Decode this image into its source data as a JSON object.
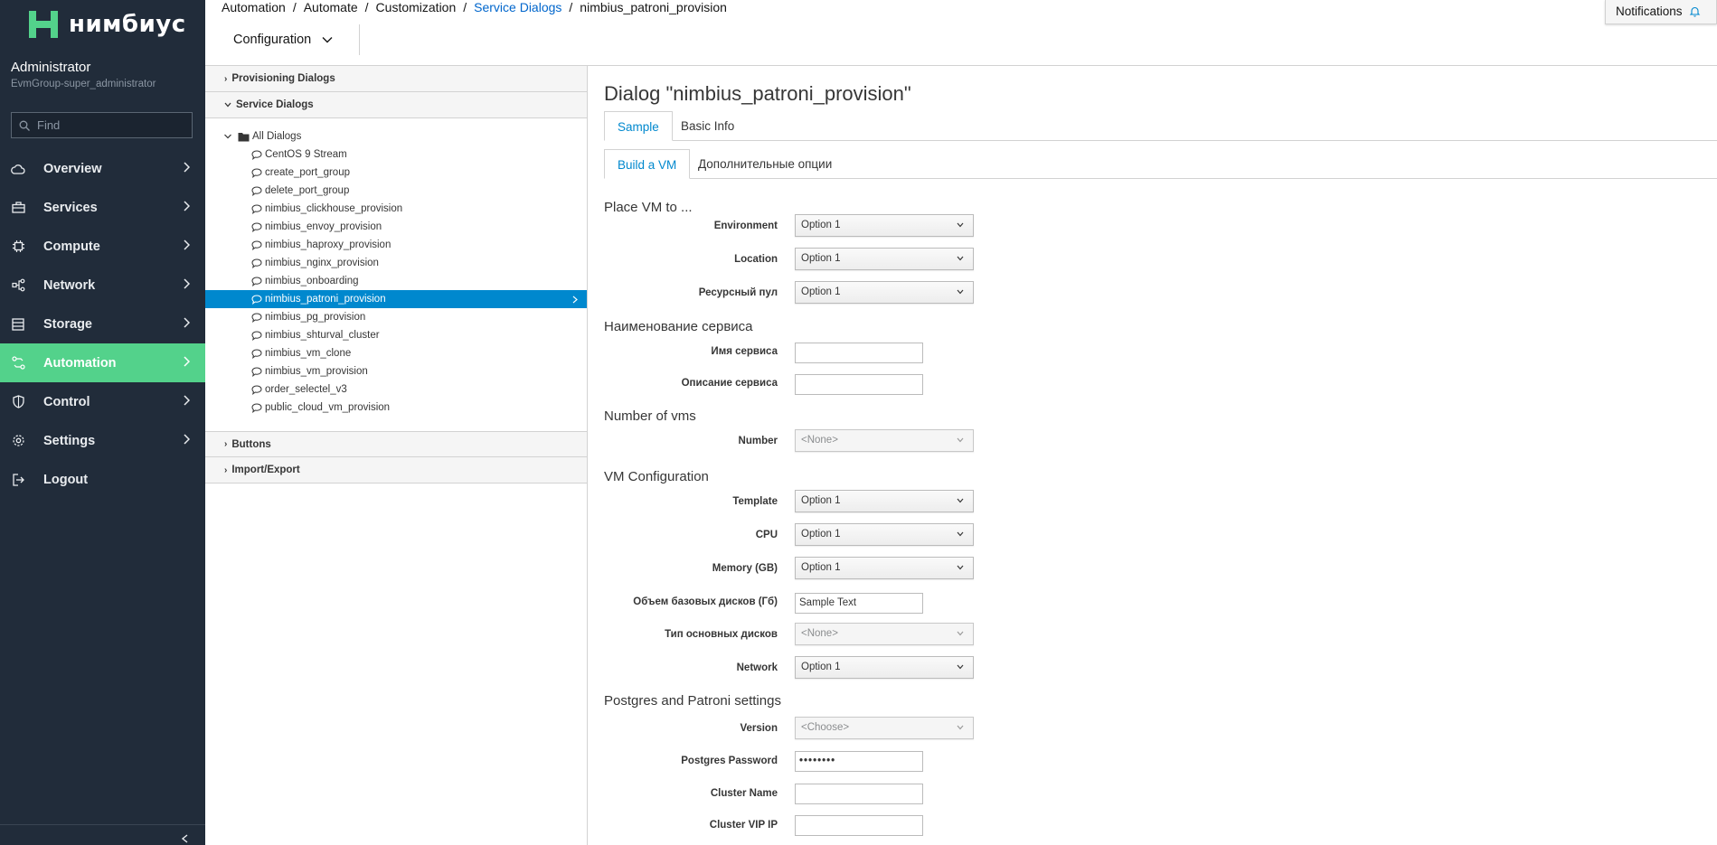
{
  "app": {
    "brand": "нимбиус",
    "user_name": "Administrator",
    "user_group": "EvmGroup-super_administrator",
    "find_placeholder": "Find",
    "brand_color": "#53d28b",
    "sidebar_bg": "#212c3a"
  },
  "nav": [
    {
      "label": "Overview",
      "icon": "cloud-icon",
      "active": false
    },
    {
      "label": "Services",
      "icon": "briefcase-icon",
      "active": false
    },
    {
      "label": "Compute",
      "icon": "cpu-icon",
      "active": false
    },
    {
      "label": "Network",
      "icon": "network-icon",
      "active": false
    },
    {
      "label": "Storage",
      "icon": "storage-icon",
      "active": false
    },
    {
      "label": "Automation",
      "icon": "automation-icon",
      "active": true
    },
    {
      "label": "Control",
      "icon": "shield-icon",
      "active": false
    },
    {
      "label": "Settings",
      "icon": "gear-icon",
      "active": false
    },
    {
      "label": "Logout",
      "icon": "logout-icon",
      "active": false
    }
  ],
  "breadcrumb": {
    "items": [
      "Automation",
      "Automate",
      "Customization",
      "Service Dialogs",
      "nimbius_patroni_provision"
    ],
    "separator": "/"
  },
  "notifications": {
    "label": "Notifications"
  },
  "toolbar": {
    "configuration_label": "Configuration"
  },
  "accordion": {
    "provisioning": "Provisioning Dialogs",
    "service": "Service Dialogs",
    "buttons": "Buttons",
    "import_export": "Import/Export"
  },
  "tree": {
    "root": "All Dialogs",
    "items": [
      "CentOS 9 Stream",
      "create_port_group",
      "delete_port_group",
      "nimbius_clickhouse_provision",
      "nimbius_envoy_provision",
      "nimbius_haproxy_provision",
      "nimbius_nginx_provision",
      "nimbius_onboarding",
      "nimbius_patroni_provision",
      "nimbius_pg_provision",
      "nimbius_shturval_cluster",
      "nimbius_vm_clone",
      "nimbius_vm_provision",
      "order_selectel_v3",
      "public_cloud_vm_provision"
    ],
    "selected_index": 8
  },
  "dialog": {
    "title": "Dialog \"nimbius_patroni_provision\"",
    "tabs": [
      "Sample",
      "Basic Info"
    ],
    "subtabs": [
      "Build a VM",
      "Дополнительные опции"
    ],
    "sections": {
      "place": "Place VM to ...",
      "service_name": "Наименование сервиса",
      "num_vms": "Number of vms",
      "vm_config": "VM Configuration",
      "postgres": "Postgres and Patroni settings"
    },
    "fields": {
      "environment": {
        "label": "Environment",
        "value": "Option 1"
      },
      "location": {
        "label": "Location",
        "value": "Option 1"
      },
      "resource_pool": {
        "label": "Ресурсный пул",
        "value": "Option 1"
      },
      "service_name": {
        "label": "Имя сервиса",
        "value": ""
      },
      "service_desc": {
        "label": "Описание сервиса",
        "value": ""
      },
      "number": {
        "label": "Number",
        "value": "<None>"
      },
      "template": {
        "label": "Template",
        "value": "Option 1"
      },
      "cpu": {
        "label": "CPU",
        "value": "Option 1"
      },
      "memory": {
        "label": "Memory (GB)",
        "value": "Option 1"
      },
      "base_disk": {
        "label": "Объем базовых дисков (Гб)",
        "value": "Sample Text"
      },
      "disk_type": {
        "label": "Тип основных дисков",
        "value": "<None>"
      },
      "network": {
        "label": "Network",
        "value": "Option 1"
      },
      "version": {
        "label": "Version",
        "value": "<Choose>"
      },
      "pg_password": {
        "label": "Postgres Password",
        "value": "••••••••"
      },
      "cluster_name": {
        "label": "Cluster Name",
        "value": ""
      },
      "cluster_vip": {
        "label": "Cluster VIP IP",
        "value": ""
      }
    }
  }
}
